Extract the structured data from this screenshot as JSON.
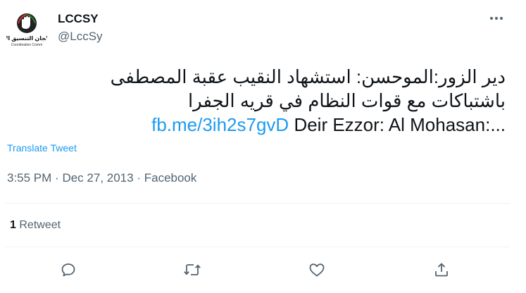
{
  "author": {
    "display_name": "LCCSY",
    "handle": "@LccSy",
    "avatar_logo_text": "لجان التنسيق المحلية",
    "avatar_logo_subtext": "Coordination Comm"
  },
  "tweet": {
    "line1": "دير الزور:الموحسن: استشهاد النقيب عقبة المصطفى",
    "line2": "باشتباكات مع قوات النظام في قريه الجفرا",
    "line3_text": "Deir Ezzor: Al Mohasan:...",
    "link": "fb.me/3ih2s7gvD"
  },
  "translate_label": "Translate Tweet",
  "meta": {
    "time": "3:55 PM",
    "separator": "·",
    "date": "Dec 27, 2013",
    "source": "Facebook"
  },
  "stats": {
    "retweet_count": "1",
    "retweet_label": "Retweet"
  },
  "icons": {
    "more": "more-icon",
    "reply": "reply-icon",
    "retweet": "retweet-icon",
    "like": "like-icon",
    "share": "share-icon"
  },
  "colors": {
    "link": "#1d9bf0",
    "secondary_text": "#536471",
    "primary_text": "#0f1419",
    "divider": "#eff3f4"
  }
}
